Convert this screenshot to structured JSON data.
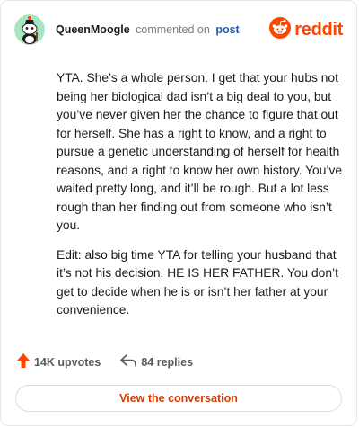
{
  "header": {
    "username": "QueenMoogle",
    "action_text": "commented on",
    "target_link": "post",
    "brand": "reddit"
  },
  "comment": {
    "paragraphs": [
      "YTA. She’s a whole person. I get that your hubs not being her biological dad isn’t a big deal to you, but you’ve never given her the chance to figure that out for herself. She has a right to know, and a right to pursue a genetic understanding of herself for health reasons, and a right to know her own history. You’ve waited pretty long, and it’ll be rough. But a lot less rough than her finding out from someone who isn’t you.",
      "Edit: also big time YTA for telling your husband that it’s not his decision. HE IS HER FATHER. You don’t get to decide when he is or isn’t her father at your convenience."
    ]
  },
  "footer": {
    "upvotes": "14K upvotes",
    "replies": "84 replies"
  },
  "cta": {
    "label": "View the conversation"
  },
  "colors": {
    "brand_orange": "#ff4500",
    "link_blue": "#2a5db0",
    "cta_text": "#d93a00"
  },
  "icons": [
    "snoo-avatar-icon",
    "reddit-logo-icon",
    "upvote-arrow-icon",
    "reply-arrow-icon"
  ]
}
